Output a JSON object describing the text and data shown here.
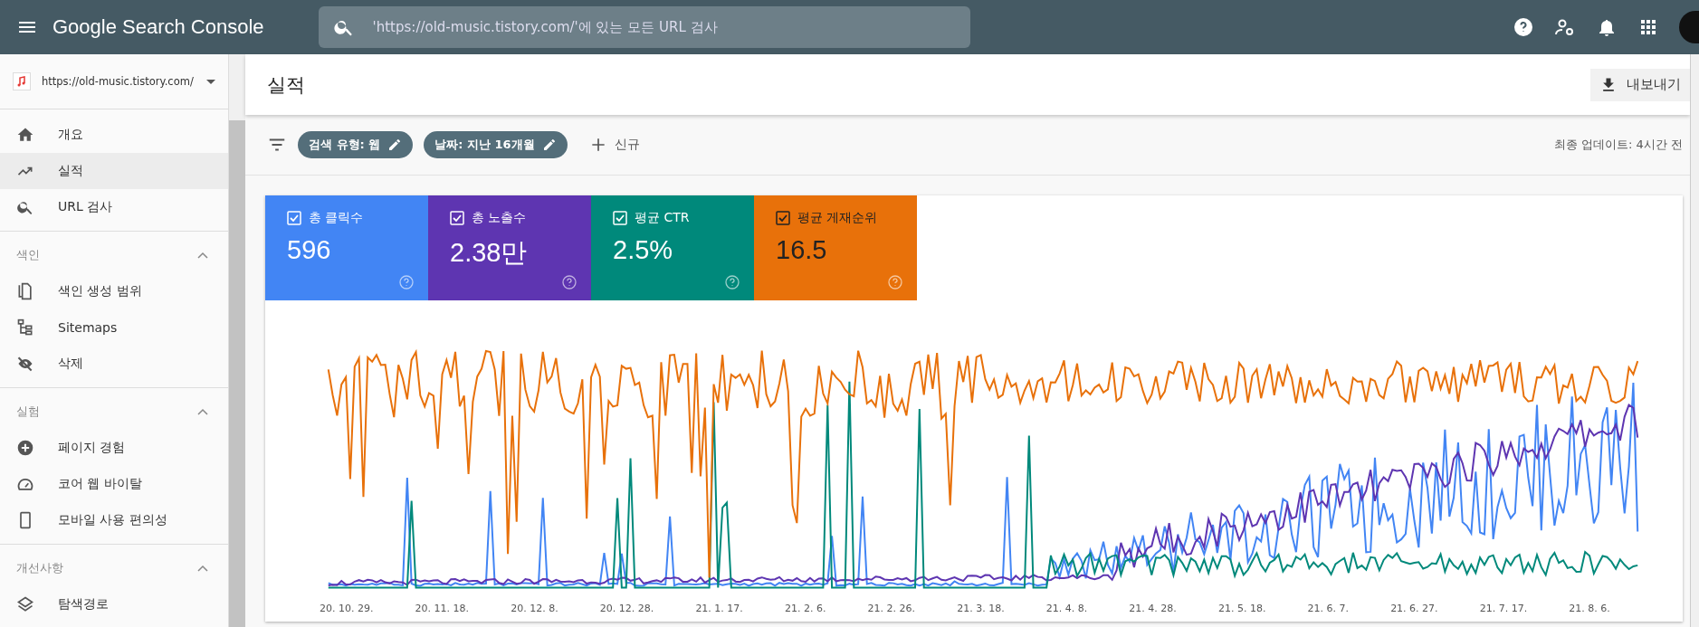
{
  "app_bar": {
    "title": "Google Search Console",
    "search_placeholder": "'https://old-music.tistory.com/'에 있는 모든 URL 검사"
  },
  "property": {
    "url": "https://old-music.tistory.com/"
  },
  "sidebar": {
    "top_items": [
      {
        "label": "개요",
        "selected": false
      },
      {
        "label": "실적",
        "selected": true
      },
      {
        "label": "URL 검사",
        "selected": false
      }
    ],
    "sections": [
      {
        "title": "색인",
        "expanded": true,
        "items": [
          {
            "label": "색인 생성 범위",
            "selected": false
          },
          {
            "label": "Sitemaps",
            "selected": false
          },
          {
            "label": "삭제",
            "selected": false
          }
        ]
      },
      {
        "title": "실험",
        "expanded": true,
        "items": [
          {
            "label": "페이지 경험",
            "selected": false
          },
          {
            "label": "코어 웹 바이탈",
            "selected": false
          },
          {
            "label": "모바일 사용 편의성",
            "selected": false
          }
        ]
      },
      {
        "title": "개선사항",
        "expanded": true,
        "items": [
          {
            "label": "탐색경로",
            "selected": false
          }
        ]
      }
    ]
  },
  "page": {
    "title": "실적",
    "export_button": "내보내기"
  },
  "filters": {
    "chips": [
      "검색 유형: 웹",
      "날짜: 지난 16개월"
    ],
    "new_button": "신규",
    "last_updated": "최종 업데이트: 4시간 전"
  },
  "metrics": [
    {
      "label": "총 클릭수",
      "value": "596",
      "checked": true,
      "color": "#4285f4"
    },
    {
      "label": "총 노출수",
      "value": "2.38만",
      "checked": true,
      "color": "#5e35b1"
    },
    {
      "label": "평균 CTR",
      "value": "2.5%",
      "checked": true,
      "color": "#00897b"
    },
    {
      "label": "평균 게재순위",
      "value": "16.5",
      "checked": true,
      "color": "#e8710a"
    }
  ],
  "chart": {
    "x_labels": [
      "20. 10. 29.",
      "20. 11. 18.",
      "20. 12. 8.",
      "20. 12. 28.",
      "21. 1. 17.",
      "21. 2. 6.",
      "21. 2. 26.",
      "21. 3. 18.",
      "21. 4. 8.",
      "21. 4. 28.",
      "21. 5. 18.",
      "21. 6. 7.",
      "21. 6. 27.",
      "21. 7. 17.",
      "21. 8. 6."
    ]
  }
}
